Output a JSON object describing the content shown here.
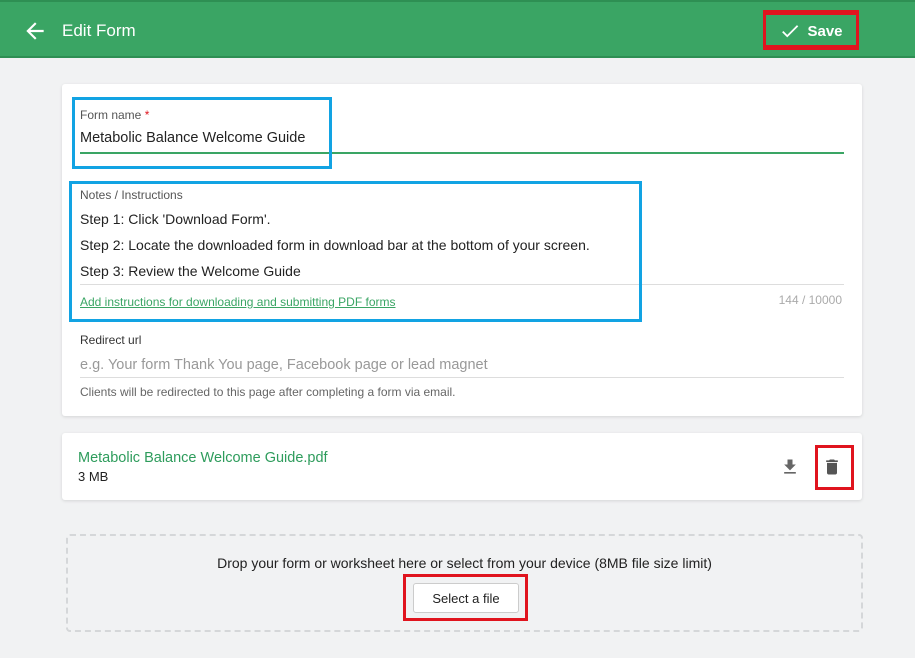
{
  "header": {
    "title": "Edit Form",
    "save_label": "Save",
    "background_color": "#3aa564"
  },
  "form": {
    "name_label": "Form name",
    "required_mark": "*",
    "name_value": "Metabolic Balance Welcome Guide",
    "notes_label": "Notes / Instructions",
    "notes_lines": [
      "Step 1: Click 'Download Form'.",
      "Step 2: Locate the downloaded form in download bar at the bottom of your screen.",
      "Step 3: Review the Welcome Guide"
    ],
    "notes_help_link": "Add instructions for downloading and submitting PDF forms",
    "notes_counter": "144 / 10000",
    "redirect_label": "Redirect url",
    "redirect_placeholder": "e.g. Your form Thank You page, Facebook page or lead magnet",
    "redirect_help": "Clients will be redirected to this page after completing a form via email."
  },
  "file": {
    "name": "Metabolic Balance Welcome Guide.pdf",
    "size": "3 MB",
    "download_icon": "download-icon",
    "delete_icon": "trash-icon"
  },
  "dropzone": {
    "text": "Drop your form or worksheet here or select from your device (8MB file size limit)",
    "button_label": "Select a file"
  },
  "annotation_colors": {
    "blue": "#12a3e3",
    "red": "#e0141e"
  }
}
